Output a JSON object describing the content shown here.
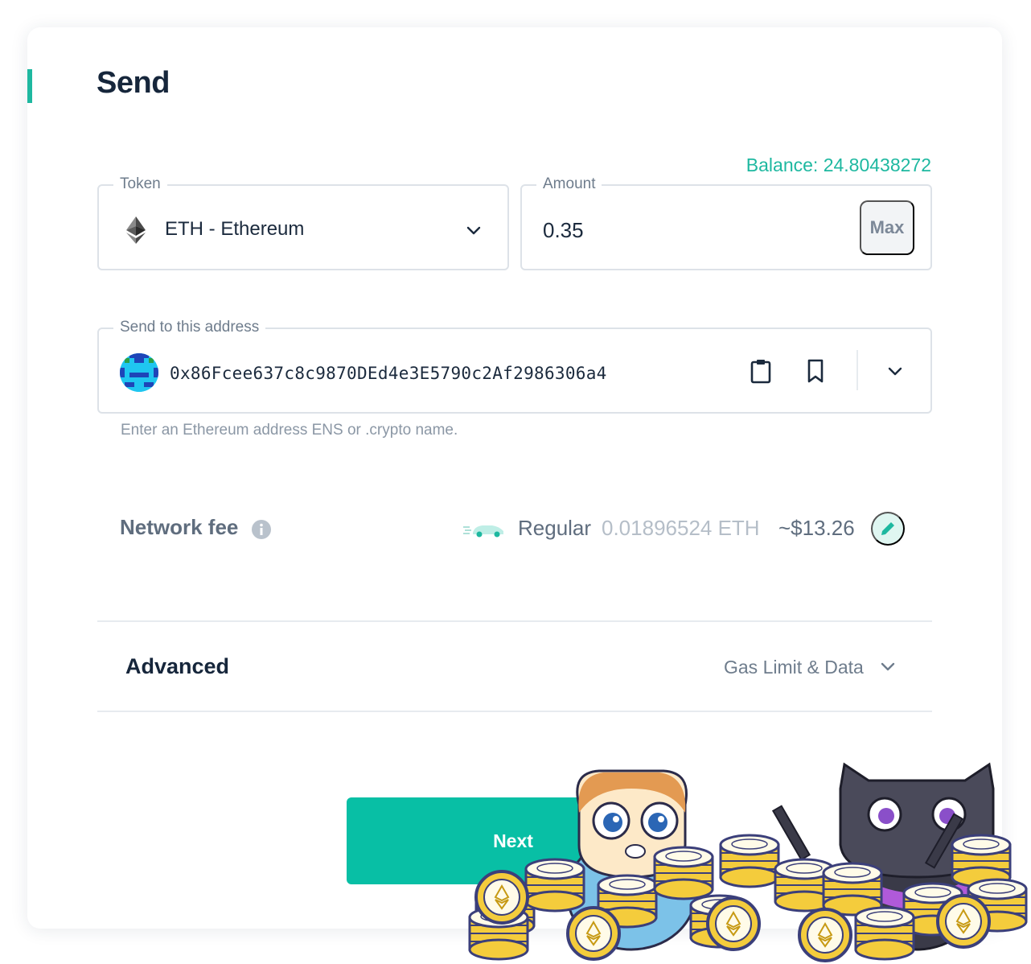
{
  "page": {
    "title": "Send"
  },
  "balance": {
    "text": "Balance: 24.80438272"
  },
  "token": {
    "label": "Token",
    "value": "ETH - Ethereum",
    "icon": "ethereum-icon"
  },
  "amount": {
    "label": "Amount",
    "value": "0.35",
    "max_label": "Max"
  },
  "address": {
    "label": "Send to this address",
    "value": "0x86Fcee637c8c9870DEd4e3E5790c2Af2986306a4",
    "helper": "Enter an Ethereum address ENS or .crypto name.",
    "icons": [
      "identicon",
      "clipboard-icon",
      "bookmark-icon",
      "chevron-down-icon"
    ]
  },
  "network_fee": {
    "label": "Network fee",
    "speed": "Regular",
    "eth": "0.01896524 ETH",
    "usd": "~$13.26",
    "icons": [
      "info-icon",
      "car-icon",
      "pencil-icon"
    ]
  },
  "advanced": {
    "title": "Advanced",
    "subtitle": "Gas Limit & Data"
  },
  "actions": {
    "next_label": "Next"
  },
  "colors": {
    "accent": "#08bfa5",
    "balance": "#1eb8a0",
    "title": "#16263b",
    "muted": "#6e7c8c",
    "border": "#dde2e8"
  }
}
